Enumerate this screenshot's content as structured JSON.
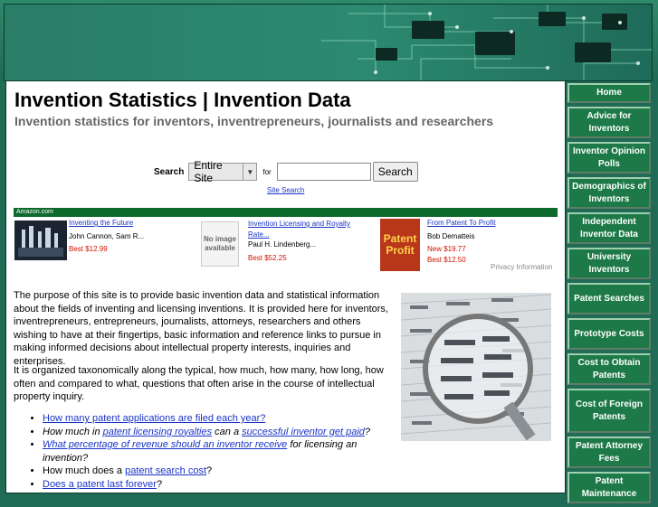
{
  "header": {
    "title": "Invention Statistics | Invention Data",
    "subtitle": "Invention statistics for inventors, inventrepreneurs, journalists and researchers"
  },
  "search": {
    "label": "Search",
    "scope_value": "Entire Site",
    "for_label": "for",
    "input_value": "",
    "button_label": "Search",
    "site_search_link": "Site Search"
  },
  "amazon": {
    "bar_label": "Amazon.com",
    "privacy": "Privacy Information",
    "items": [
      {
        "title": "Inventing the Future",
        "author": "John Cannon, Sam R...",
        "prices": [
          "Best $12.99"
        ],
        "image": "book-cover"
      },
      {
        "title": "Invention Licensing and Royalty Rate...",
        "author": "Paul H. Lindenberg...",
        "prices": [
          "Best $52.25"
        ],
        "image": "no-image",
        "no_image_text": "No image available"
      },
      {
        "title": "From Patent To Profit",
        "author": "Bob Dematteis",
        "prices": [
          "New $19.77",
          "Best $12.50"
        ],
        "image": "book-cover",
        "cover_text": "Patent Profit"
      }
    ]
  },
  "content": {
    "p1": "The purpose of this site is to provide basic invention data and statistical information about the fields of inventing and licensing inventions.  It is provided here for inventors, inventrepreneurs, entrepreneurs, journalists, attorneys, researchers and others wishing to have at their fingertips, basic information and reference links to pursue in making informed decisions about intellectual property interests, inquiries and enterprises.",
    "p2": "It is organized taxonomically along the typical, how much, how many, how long, how often and compared to what, questions that often arise in the course of intellectual property inquiry.",
    "q1_link": "How many patent applications are filed each year?",
    "q2_pre": "How much in ",
    "q2_link1": "patent licensing royalties",
    "q2_mid": " can a ",
    "q2_link2": "successful inventor get paid",
    "q2_post": "?",
    "q3_link": "What percentage of revenue should an inventor receive",
    "q3_post": " for licensing an invention?",
    "q4_pre": "How much does a ",
    "q4_link": "patent search cost",
    "q4_post": "?",
    "q5_link": "Does a patent last forever",
    "q5_post": "?"
  },
  "sidebar": {
    "items": [
      {
        "label": "Home"
      },
      {
        "label": "Advice for Inventors"
      },
      {
        "label": "Inventor Opinion Polls"
      },
      {
        "label": "Demographics of Inventors"
      },
      {
        "label": "Independent Inventor Data"
      },
      {
        "label": "University Inventors"
      },
      {
        "label": "Patent Searches"
      },
      {
        "label": "Prototype Costs"
      },
      {
        "label": "Cost to Obtain Patents"
      },
      {
        "label": "Cost of Foreign Patents"
      },
      {
        "label": "Patent Attorney Fees"
      },
      {
        "label": "Patent Maintenance"
      }
    ]
  },
  "colors": {
    "page_bg": "#1f6b55",
    "nav_bg": "#1d7a48",
    "amazon_bar": "#0c6a2c",
    "link": "#1a33c8",
    "price": "#cc1100"
  }
}
